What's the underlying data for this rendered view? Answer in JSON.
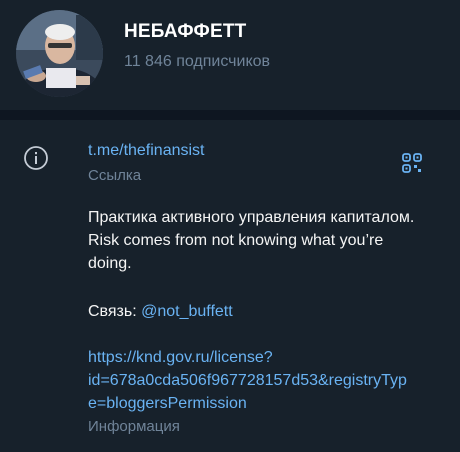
{
  "channel": {
    "name": "НЕБАФФЕТТ",
    "subscribers": "11 846 подписчиков"
  },
  "info": {
    "username_link": "t.me/thefinansist",
    "username_caption": "Ссылка",
    "description_line1": "Практика активного управления капиталом. Risk comes from not knowing what you’re doing.",
    "contact_label": "Связь: ",
    "contact_handle": "@not_buffett",
    "license_line1": "https://knd.gov.ru/license?",
    "license_line2": "id=678a0cda506f967728157d53&registryTyp",
    "license_line3": "e=bloggersPermission",
    "description_caption": "Информация"
  },
  "colors": {
    "background": "#17212b",
    "separator": "#0e1621",
    "link": "#6ab3f3",
    "secondary_text": "#708499"
  },
  "icons": {
    "info": "info-circle-icon",
    "qr": "qr-code-icon"
  }
}
